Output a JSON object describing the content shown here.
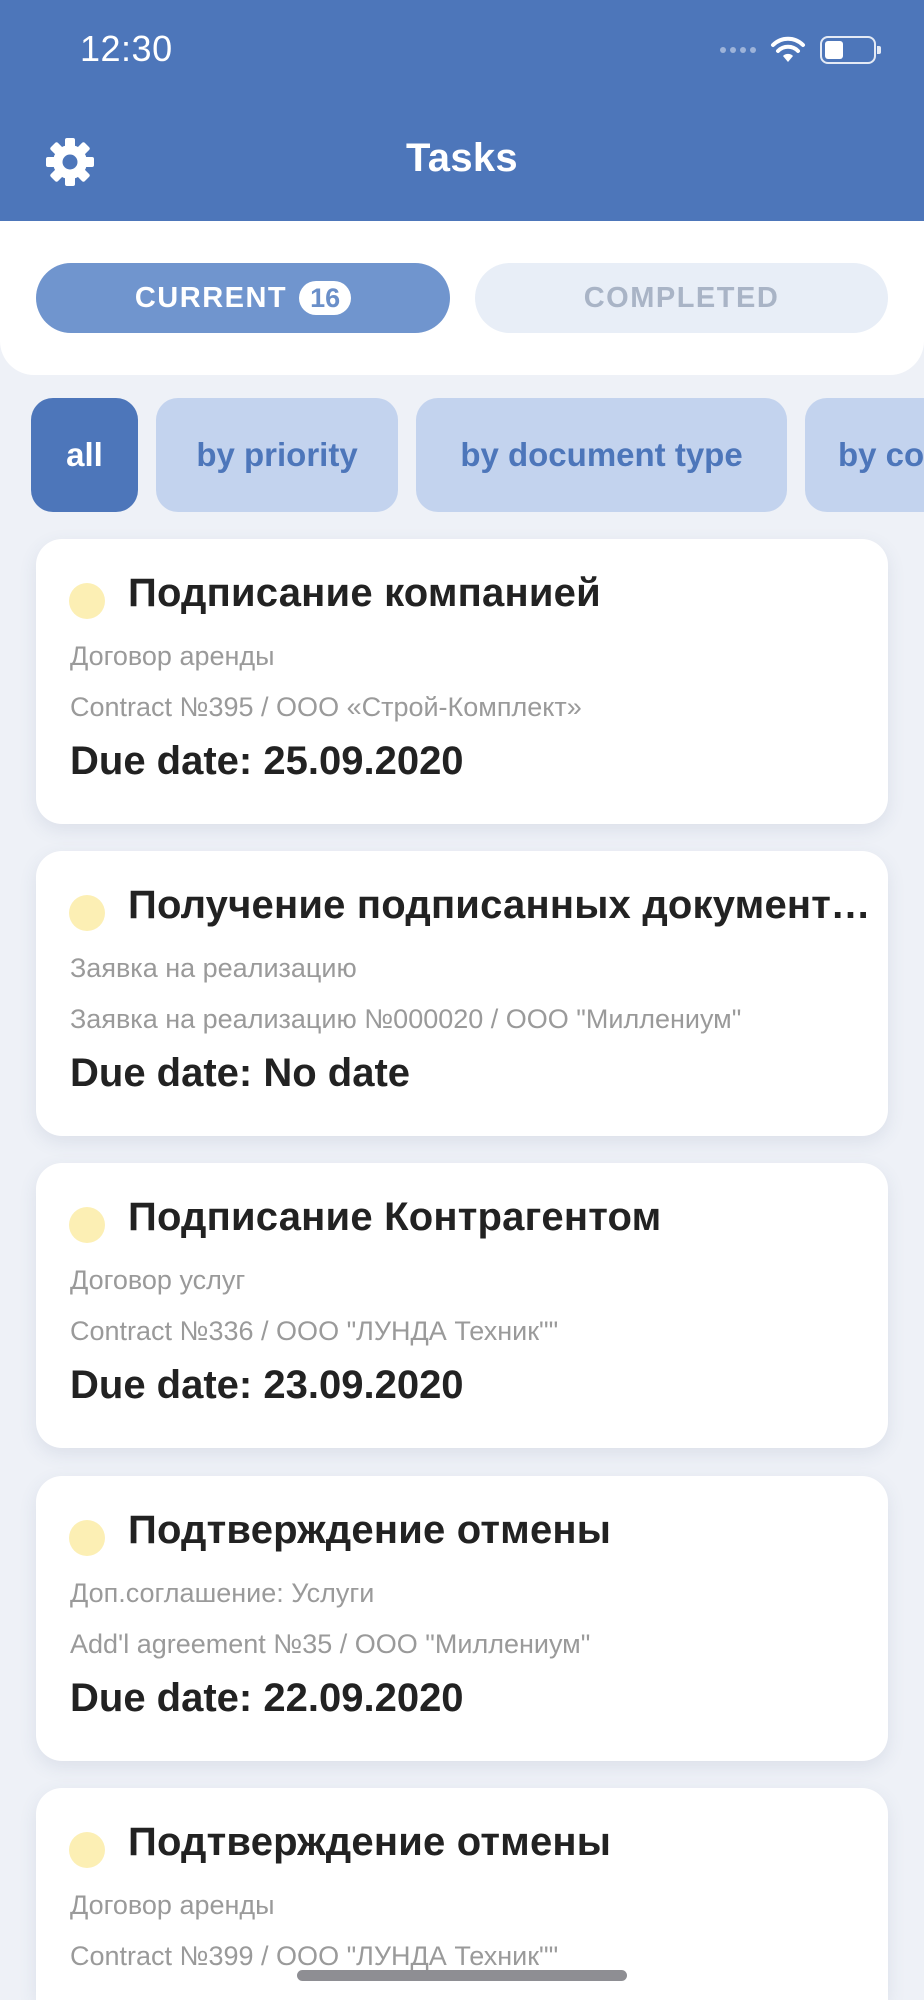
{
  "status_bar": {
    "time": "12:30"
  },
  "header": {
    "title": "Tasks",
    "settings_icon": "gear-icon"
  },
  "segments": {
    "current_label": "CURRENT",
    "current_count": "16",
    "completed_label": "COMPLETED"
  },
  "filters": [
    "all",
    "by priority",
    "by document type",
    "by contractor"
  ],
  "tasks": [
    {
      "title": "Подписание компанией",
      "doc_type": "Договор аренды",
      "contract": "Contract №395 / ООО «Строй-Комплект»",
      "due": "Due date: 25.09.2020"
    },
    {
      "title": "Получение подписанных документов",
      "doc_type": "Заявка на реализацию",
      "contract": "Заявка на реализацию №000020 / ООО \"Миллениум\"",
      "due": "Due date: No date"
    },
    {
      "title": "Подписание Контрагентом",
      "doc_type": "Договор услуг",
      "contract": "Contract №336 / ООО \"ЛУНДА Техник\"\"",
      "due": "Due date: 23.09.2020"
    },
    {
      "title": "Подтверждение отмены",
      "doc_type": "Доп.соглашение: Услуги",
      "contract": "Add'l agreement №35 / ООО \"Миллениум\"",
      "due": "Due date: 22.09.2020"
    },
    {
      "title": "Подтверждение отмены",
      "doc_type": "Договор аренды",
      "contract": "Contract №399 / ООО \"ЛУНДА Техник\"\"",
      "due": ""
    }
  ],
  "colors": {
    "header": "#4d76ba",
    "segment_active": "#7095ce",
    "chip_active": "#4d76ba",
    "chip_inactive": "#c3d3ee",
    "status_dot": "#fcefb4"
  }
}
